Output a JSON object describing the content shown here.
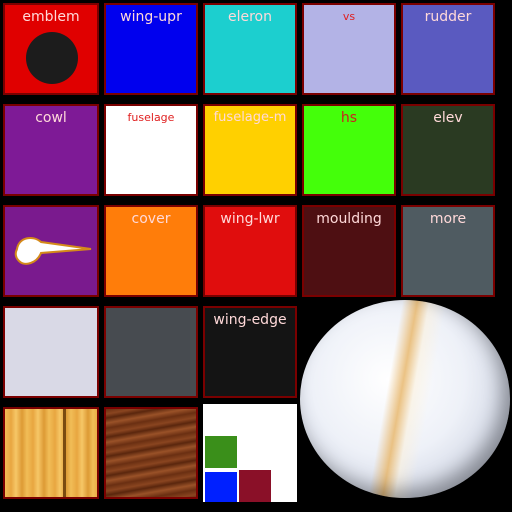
{
  "atlas": {
    "tiles": [
      {
        "label": "emblem",
        "color": "#e00000"
      },
      {
        "label": "wing-upr",
        "color": "#0000ee"
      },
      {
        "label": "eleron",
        "color": "#1ccfcf"
      },
      {
        "label": "vs",
        "color": "#b3b3e6"
      },
      {
        "label": "rudder",
        "color": "#5a5ac0"
      },
      {
        "label": "cowl",
        "color": "#7e1a96"
      },
      {
        "label": "fuselage",
        "color": "#ffffff"
      },
      {
        "label": "fuselage-m",
        "color": "#ffd000"
      },
      {
        "label": "hs",
        "color": "#44ff0a"
      },
      {
        "label": "elev",
        "color": "#2a3a22"
      },
      {
        "label": "",
        "color": "#7a1a8e"
      },
      {
        "label": "cover",
        "color": "#ff7d0a"
      },
      {
        "label": "wing-lwr",
        "color": "#e00d0d"
      },
      {
        "label": "moulding",
        "color": "#4e0f12"
      },
      {
        "label": "more",
        "color": "#4f5b61"
      },
      {
        "label": "",
        "color": "#d9d9e6"
      },
      {
        "label": "",
        "color": "#474b50"
      },
      {
        "label": "wing-edge",
        "color": "#141414"
      },
      {
        "label": "",
        "color": "#f1bd57"
      },
      {
        "label": "",
        "color": "#7a3a18"
      },
      {
        "label": "",
        "color": "#ffffff"
      }
    ],
    "swatch_colors": [
      "#3a8f1a",
      "#0020ff",
      "#8a1028"
    ]
  }
}
